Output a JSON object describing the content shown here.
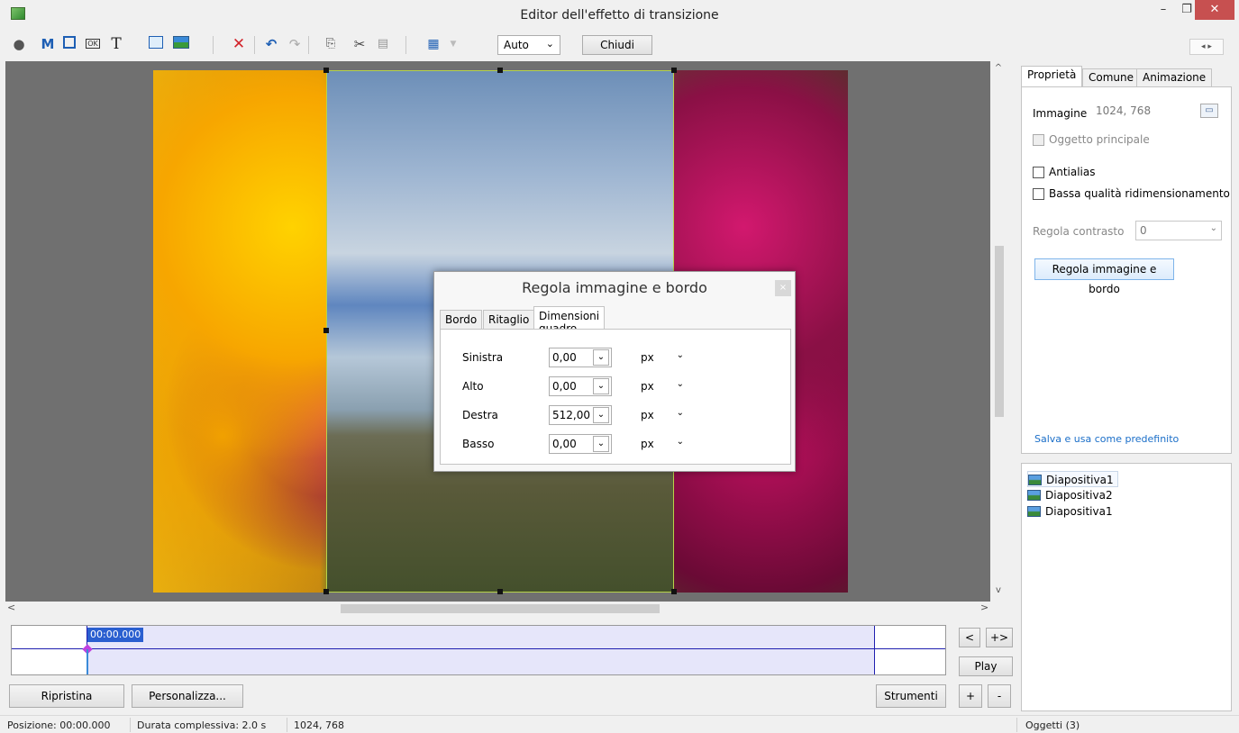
{
  "window": {
    "title": "Editor dell'effetto di transizione",
    "min": "–",
    "max": "❐",
    "close": "✕"
  },
  "toolbar": {
    "zoom_value": "Auto",
    "close_label": "Chiudi",
    "icons": [
      "camera-icon",
      "text-m-icon",
      "frame-icon",
      "ok-button-icon",
      "text-t-icon",
      "rectangle-icon",
      "image-icon",
      "delete-icon",
      "undo-icon",
      "redo-icon",
      "copy-icon",
      "cut-icon",
      "paste-icon",
      "grid-icon"
    ],
    "nav_arrows": "◂ ▸"
  },
  "dialog": {
    "title": "Regola immagine e bordo",
    "close": "×",
    "tabs": [
      "Bordo",
      "Ritaglio",
      "Dimensioni quadro"
    ],
    "active_tab": "Dimensioni quadro",
    "rows": [
      {
        "label": "Sinistra",
        "value": "0,00",
        "unit": "px"
      },
      {
        "label": "Alto",
        "value": "0,00",
        "unit": "px"
      },
      {
        "label": "Destra",
        "value": "512,00",
        "unit": "px"
      },
      {
        "label": "Basso",
        "value": "0,00",
        "unit": "px"
      }
    ]
  },
  "right_panel": {
    "tabs": [
      "Proprietà",
      "Comune",
      "Animazione"
    ],
    "active_tab": "Proprietà",
    "image_label": "Immagine",
    "image_value": "1024, 768",
    "main_object": "Oggetto principale",
    "antialias": "Antialias",
    "low_quality": "Bassa qualità ridimensionamento",
    "contrast_label": "Regola contrasto",
    "contrast_value": "0",
    "adjust_button": "Regola immagine e bordo",
    "save_default": "Salva e usa come predefinito"
  },
  "slides": [
    "Diapositiva1",
    "Diapositiva2",
    "Diapositiva1"
  ],
  "timeline": {
    "time": "00:00.000",
    "prev": "<",
    "next": "+>",
    "play": "Play"
  },
  "bottom": {
    "reset": "Ripristina",
    "customize": "Personalizza...",
    "tools": "Strumenti",
    "plus": "+",
    "minus": "-"
  },
  "status": {
    "position": "Posizione: 00:00.000",
    "duration": "Durata complessiva: 2.0 s",
    "size": "1024, 768",
    "objects": "Oggetti (3)"
  }
}
